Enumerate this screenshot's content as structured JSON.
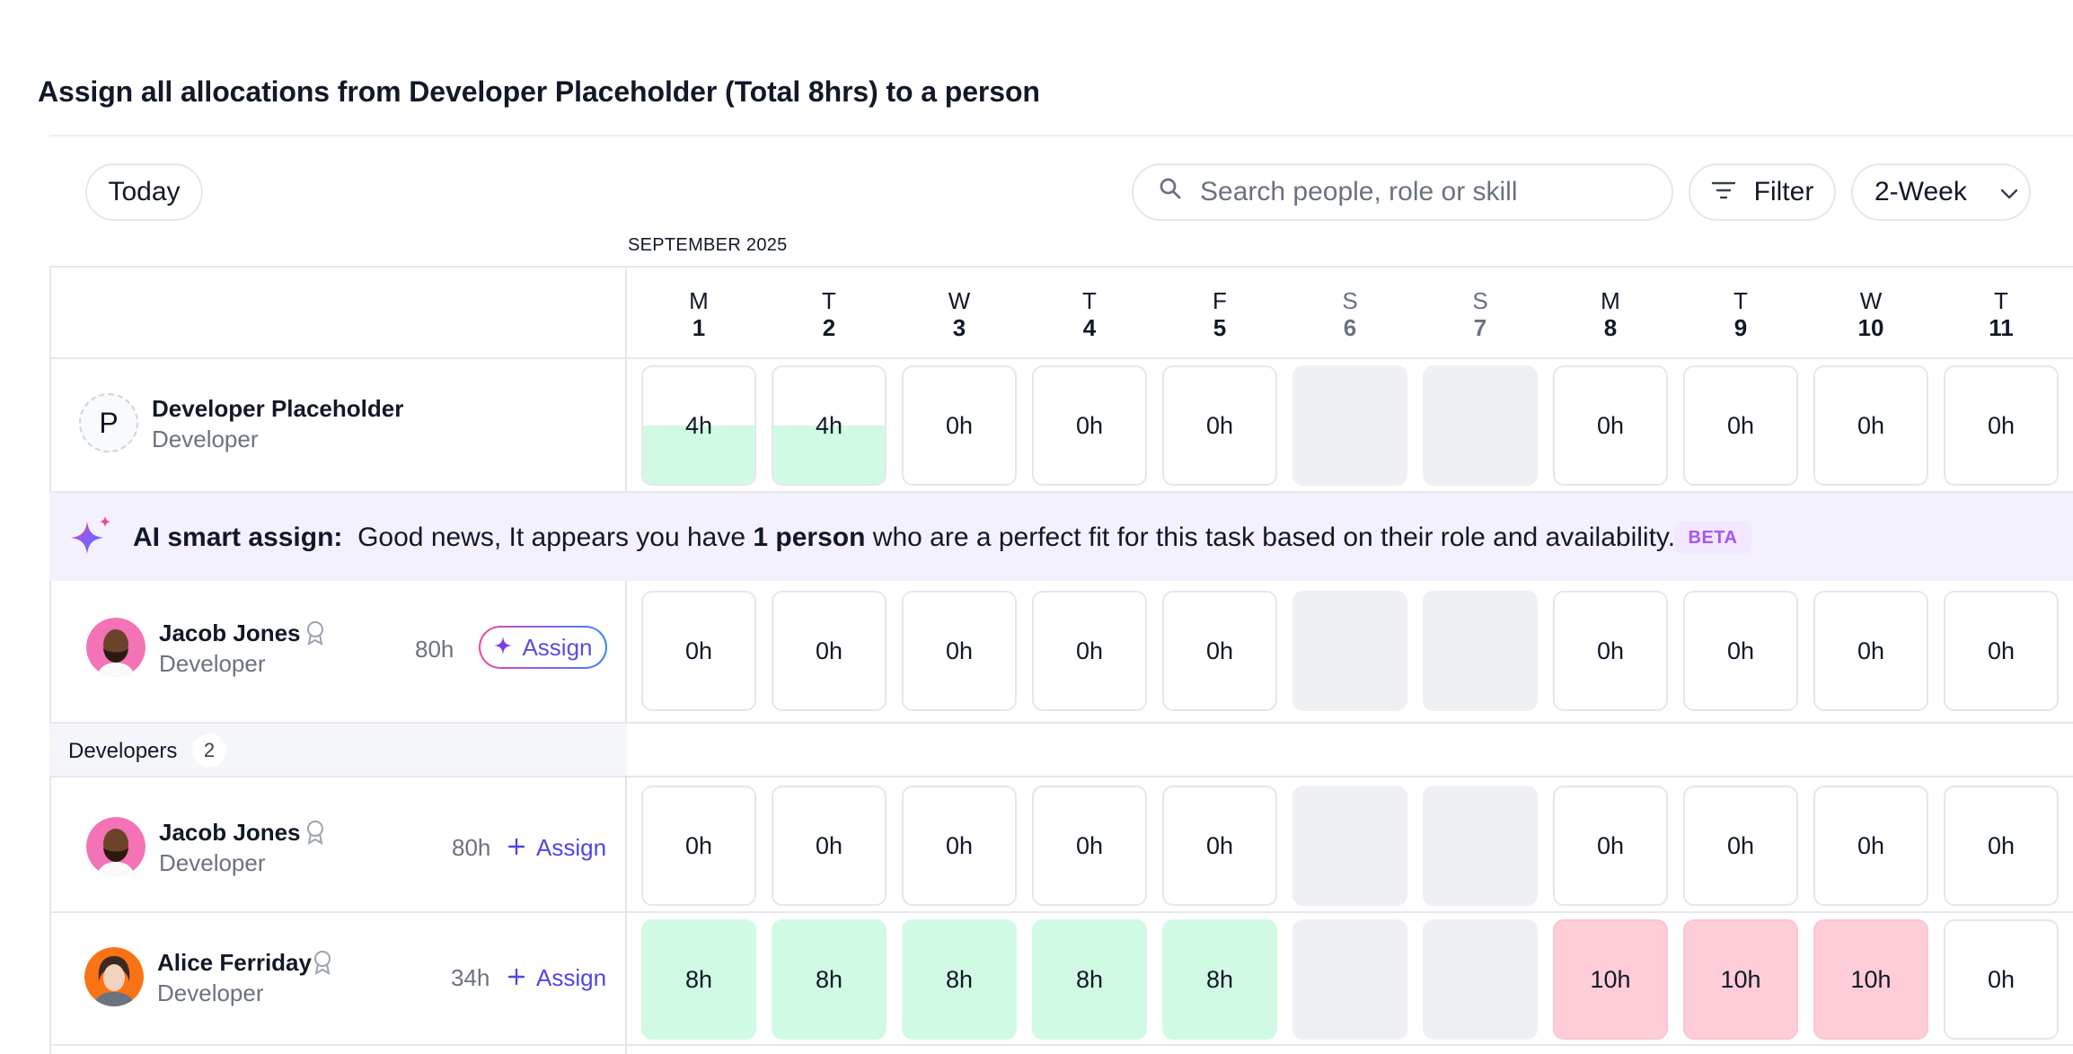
{
  "title": "Assign all allocations from Developer Placeholder (Total 8hrs) to a person",
  "toolbar": {
    "today_label": "Today",
    "search_placeholder": "Search people, role or skill",
    "filter_label": "Filter",
    "range_label": "2-Week"
  },
  "calendar": {
    "month": "SEPTEMBER 2025",
    "days": [
      {
        "letter": "M",
        "num": "1",
        "weekend": false
      },
      {
        "letter": "T",
        "num": "2",
        "weekend": false
      },
      {
        "letter": "W",
        "num": "3",
        "weekend": false
      },
      {
        "letter": "T",
        "num": "4",
        "weekend": false
      },
      {
        "letter": "F",
        "num": "5",
        "weekend": false
      },
      {
        "letter": "S",
        "num": "6",
        "weekend": true
      },
      {
        "letter": "S",
        "num": "7",
        "weekend": true
      },
      {
        "letter": "M",
        "num": "8",
        "weekend": false
      },
      {
        "letter": "T",
        "num": "9",
        "weekend": false
      },
      {
        "letter": "W",
        "num": "10",
        "weekend": false
      },
      {
        "letter": "T",
        "num": "11",
        "weekend": false
      }
    ]
  },
  "placeholder": {
    "initial": "P",
    "name": "Developer Placeholder",
    "role": "Developer",
    "cells": [
      {
        "text": "4h",
        "fill": 0.5
      },
      {
        "text": "4h",
        "fill": 0.5
      },
      {
        "text": "0h"
      },
      {
        "text": "0h"
      },
      {
        "text": "0h"
      },
      {
        "text": "",
        "weekend": true
      },
      {
        "text": "",
        "weekend": true
      },
      {
        "text": "0h"
      },
      {
        "text": "0h"
      },
      {
        "text": "0h"
      },
      {
        "text": "0h"
      }
    ]
  },
  "ai_banner": {
    "label": "AI smart assign:",
    "text_before": "Good news, It appears you have",
    "highlight": "1 person",
    "text_after": "who are a perfect fit for this task based on their role and availability.",
    "badge": "BETA"
  },
  "suggested": {
    "name": "Jacob Jones",
    "role": "Developer",
    "hours": "80h",
    "assign_label": "Assign",
    "cells": [
      {
        "text": "0h"
      },
      {
        "text": "0h"
      },
      {
        "text": "0h"
      },
      {
        "text": "0h"
      },
      {
        "text": "0h"
      },
      {
        "text": "",
        "weekend": true
      },
      {
        "text": "",
        "weekend": true
      },
      {
        "text": "0h"
      },
      {
        "text": "0h"
      },
      {
        "text": "0h"
      },
      {
        "text": "0h"
      }
    ]
  },
  "group": {
    "label": "Developers",
    "count": "2"
  },
  "people": [
    {
      "name": "Jacob Jones",
      "role": "Developer",
      "hours": "80h",
      "assign_label": "Assign",
      "cells": [
        {
          "text": "0h"
        },
        {
          "text": "0h"
        },
        {
          "text": "0h"
        },
        {
          "text": "0h"
        },
        {
          "text": "0h"
        },
        {
          "text": "",
          "weekend": true
        },
        {
          "text": "",
          "weekend": true
        },
        {
          "text": "0h"
        },
        {
          "text": "0h"
        },
        {
          "text": "0h"
        },
        {
          "text": "0h"
        }
      ]
    },
    {
      "name": "Alice Ferriday",
      "role": "Developer",
      "hours": "34h",
      "assign_label": "Assign",
      "cells": [
        {
          "text": "8h",
          "status": "ok"
        },
        {
          "text": "8h",
          "status": "ok"
        },
        {
          "text": "8h",
          "status": "ok"
        },
        {
          "text": "8h",
          "status": "ok"
        },
        {
          "text": "8h",
          "status": "ok"
        },
        {
          "text": "",
          "weekend": true
        },
        {
          "text": "",
          "weekend": true
        },
        {
          "text": "10h",
          "status": "over"
        },
        {
          "text": "10h",
          "status": "over"
        },
        {
          "text": "10h",
          "status": "over"
        },
        {
          "text": "0h"
        }
      ]
    }
  ],
  "colors": {
    "available": "#d1fae5",
    "overbooked": "#fecdd8",
    "weekend": "#eef0f4",
    "accent": "#4f46e5"
  }
}
